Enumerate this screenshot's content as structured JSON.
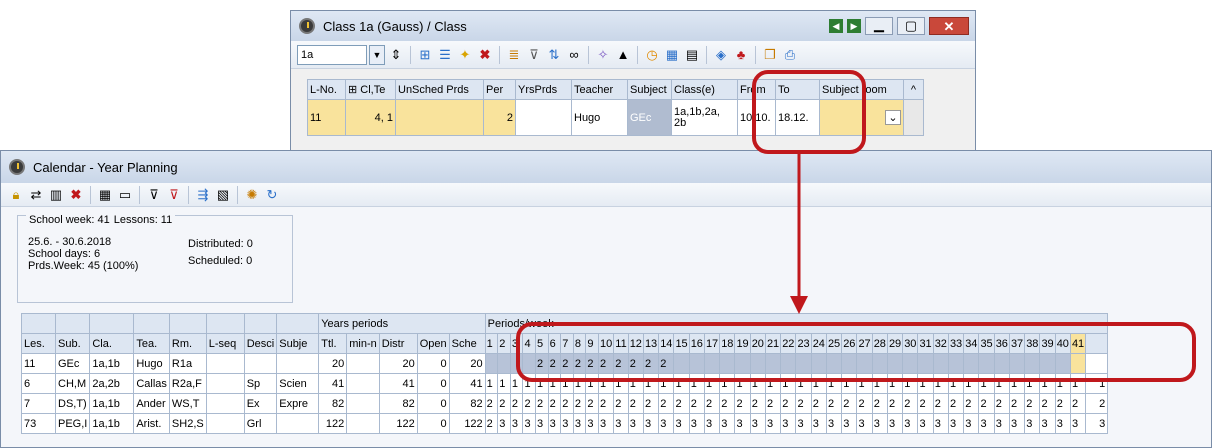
{
  "class_window": {
    "title": "Class 1a (Gauss) / Class",
    "class_select": "1a",
    "toolbar_icons": [
      "spin-icon",
      "grid-icon",
      "columns-icon",
      "new-icon",
      "delete-icon",
      "list-icon",
      "filter-icon",
      "sort-icon",
      "link-icon",
      "wand-icon",
      "hat-icon",
      "clock-icon",
      "calendar-icon",
      "table-icon",
      "lookup-icon",
      "person-icon",
      "copy-icon",
      "print-icon"
    ],
    "columns": [
      "L-No.",
      "⊞ Cl,Te",
      "UnSched Prds",
      "Per",
      "YrsPrds",
      "Teacher",
      "Subject",
      "Class(e)",
      "From",
      "To",
      "Subject room"
    ],
    "row": {
      "lno": "11",
      "clte": "4, 1",
      "unsched": "",
      "per": "2",
      "yrsprds": "",
      "teacher": "Hugo",
      "subject": "GEc",
      "classes": "1a,1b,2a,\n2b",
      "from": "10.10.",
      "to": "18.12.",
      "room": ""
    }
  },
  "calendar_window": {
    "title": "Calendar - Year Planning",
    "toolbar_icons": [
      "lock-icon",
      "transfer-icon",
      "book-icon",
      "delete-icon",
      "calc-icon",
      "edit-icon",
      "filter-icon",
      "clear-filter-icon",
      "distribute-icon",
      "schedule-icon",
      "settings-icon",
      "refresh-icon"
    ],
    "info": {
      "school_week": "School week: 41",
      "lessons": "Lessons: 11",
      "date_range": "25.6. - 30.6.2018",
      "school_days": "School days: 6",
      "prds_week": "Prds.Week: 45 (100%)",
      "distributed": "Distributed: 0",
      "scheduled": "Scheduled: 0"
    },
    "group_headers": {
      "years_periods": "Years periods",
      "periods_week": "Periods/week"
    },
    "columns": [
      "Les.",
      "Sub.",
      "Cla.",
      "Tea.",
      "Rm.",
      "L-seq",
      "Desci",
      "Subje",
      "Ttl.",
      "min-n",
      "Distr",
      "Open",
      "Sche"
    ],
    "week_numbers": [
      "1",
      "2",
      "3",
      "4",
      "5",
      "6",
      "7",
      "8",
      "9",
      "10",
      "11",
      "12",
      "13",
      "14",
      "15",
      "16",
      "17",
      "18",
      "19",
      "20",
      "21",
      "22",
      "23",
      "24",
      "25",
      "26",
      "27",
      "28",
      "29",
      "30",
      "31",
      "32",
      "33",
      "34",
      "35",
      "36",
      "37",
      "38",
      "39",
      "40",
      "41"
    ],
    "rows": [
      {
        "les": "11",
        "sub": "GEc",
        "cla": "1a,1b",
        "tea": "Hugo",
        "rm": "R1a",
        "lseq": "",
        "desc": "",
        "subj": "",
        "ttl": "20",
        "min": "",
        "distr": "20",
        "open": "0",
        "sche": "20",
        "weeks": [
          "",
          "",
          "",
          "",
          "2",
          "2",
          "2",
          "2",
          "2",
          "2",
          "2",
          "2",
          "2",
          "2",
          "",
          "",
          "",
          "",
          "",
          "",
          "",
          "",
          "",
          "",
          "",
          "",
          "",
          "",
          "",
          "",
          "",
          "",
          "",
          "",
          "",
          "",
          "",
          "",
          "",
          "",
          ""
        ],
        "extra": ""
      },
      {
        "les": "6",
        "sub": "CH,M",
        "cla": "2a,2b",
        "tea": "Callas",
        "rm": "R2a,F",
        "lseq": "",
        "desc": "Sp",
        "subj": "Scien",
        "ttl": "41",
        "min": "",
        "distr": "41",
        "open": "0",
        "sche": "41",
        "weeks": [
          "1",
          "1",
          "1",
          "1",
          "1",
          "1",
          "1",
          "1",
          "1",
          "1",
          "1",
          "1",
          "1",
          "1",
          "1",
          "1",
          "1",
          "1",
          "1",
          "1",
          "1",
          "1",
          "1",
          "1",
          "1",
          "1",
          "1",
          "1",
          "1",
          "1",
          "1",
          "1",
          "1",
          "1",
          "1",
          "1",
          "1",
          "1",
          "1",
          "1",
          "1"
        ],
        "extra": "1"
      },
      {
        "les": "7",
        "sub": "DS,T)",
        "cla": "1a,1b",
        "tea": "Ander",
        "rm": "WS,T",
        "lseq": "",
        "desc": "Ex",
        "subj": "Expre",
        "ttl": "82",
        "min": "",
        "distr": "82",
        "open": "0",
        "sche": "82",
        "weeks": [
          "2",
          "2",
          "2",
          "2",
          "2",
          "2",
          "2",
          "2",
          "2",
          "2",
          "2",
          "2",
          "2",
          "2",
          "2",
          "2",
          "2",
          "2",
          "2",
          "2",
          "2",
          "2",
          "2",
          "2",
          "2",
          "2",
          "2",
          "2",
          "2",
          "2",
          "2",
          "2",
          "2",
          "2",
          "2",
          "2",
          "2",
          "2",
          "2",
          "2",
          "2"
        ],
        "extra": "2"
      },
      {
        "les": "73",
        "sub": "PEG,I",
        "cla": "1a,1b",
        "tea": "Arist.",
        "rm": "SH2,S",
        "lseq": "",
        "desc": "Grl",
        "subj": "",
        "ttl": "122",
        "min": "",
        "distr": "122",
        "open": "0",
        "sche": "122",
        "weeks": [
          "2",
          "3",
          "3",
          "3",
          "3",
          "3",
          "3",
          "3",
          "3",
          "3",
          "3",
          "3",
          "3",
          "3",
          "3",
          "3",
          "3",
          "3",
          "3",
          "3",
          "3",
          "3",
          "3",
          "3",
          "3",
          "3",
          "3",
          "3",
          "3",
          "3",
          "3",
          "3",
          "3",
          "3",
          "3",
          "3",
          "3",
          "3",
          "3",
          "3",
          "3"
        ],
        "extra": "3"
      }
    ]
  },
  "colors": {
    "highlight": "#c0181c",
    "selected": "#f9e39c",
    "grey_cell": "#b0bcd0",
    "header": "#dde6f2"
  }
}
